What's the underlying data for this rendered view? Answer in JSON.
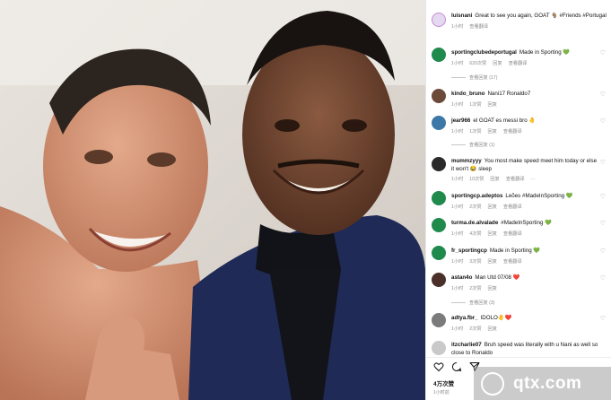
{
  "caption": {
    "user": "luisnani",
    "text": "Great to see you again, GOAT 🐐 #Friends #Portugal",
    "time": "1小时",
    "action": "查看翻译"
  },
  "comments": [
    {
      "user": "sportingclubedeportugal",
      "text": "Made in Sporting 💚",
      "time": "1小时",
      "likes": "620次赞",
      "reply": "回复",
      "translate": "查看翻译",
      "more_replies": "查看回复 (17)",
      "avatar_color": "#1f8a4c"
    },
    {
      "user": "kindo_bruno",
      "text": "Nani17 Ronaldo7",
      "time": "1小时",
      "likes": "1次赞",
      "reply": "回复",
      "avatar_color": "#6b4a3a"
    },
    {
      "user": "jear966",
      "text": "el GOAT es messi bro 🤚",
      "time": "1小时",
      "likes": "1次赞",
      "reply": "回复",
      "translate": "查看翻译",
      "more_replies": "查看回复 (1)",
      "avatar_color": "#3b78a8"
    },
    {
      "user": "mummzyyy",
      "text": "You most make speed meet him today or else it won't 😂 sleep",
      "time": "1小时",
      "likes": "10次赞",
      "reply": "回复",
      "translate": "查看翻译",
      "extra": "···",
      "avatar_color": "#2a2a2a"
    },
    {
      "user": "sportingcp.adeptos",
      "text": "Leões #MadeInSporting 💚",
      "time": "1小时",
      "likes": "2次赞",
      "reply": "回复",
      "translate": "查看翻译",
      "avatar_color": "#1f8a4c"
    },
    {
      "user": "turma.de.alvalade",
      "text": "#MadeInSporting 💚",
      "time": "1小时",
      "likes": "4次赞",
      "reply": "回复",
      "translate": "查看翻译",
      "avatar_color": "#1f8a4c"
    },
    {
      "user": "fr_sportingcp",
      "text": "Made in Sporting 💚",
      "time": "1小时",
      "likes": "3次赞",
      "reply": "回复",
      "translate": "查看翻译",
      "avatar_color": "#1f8a4c"
    },
    {
      "user": "astan4o",
      "text": "Man Utd 07/08 ❤️",
      "time": "1小时",
      "likes": "2次赞",
      "reply": "回复",
      "more_replies": "查看回复 (3)",
      "avatar_color": "#4a3028"
    },
    {
      "user": "adtya.fbr_",
      "text": "IDOLO🤚❤️",
      "time": "1小时",
      "likes": "2次赞",
      "reply": "回复",
      "avatar_color": "#7b7b7b"
    },
    {
      "user": "itzcharlie07",
      "text": "Bruh speed was literally with u Nani as well so close to Ronaldo",
      "avatar_color": "#c9c9c9"
    }
  ],
  "footer": {
    "likes": "4万次赞",
    "time": "1小时前"
  },
  "icons": {
    "like": "heart-icon",
    "comment": "comment-icon",
    "share": "share-icon",
    "comment_like": "heart-outline-icon"
  },
  "watermark": {
    "text": "qtx.com"
  },
  "colors": {
    "heart_green": "#3cb043",
    "text": "#111111",
    "meta": "#8a8a8a"
  }
}
